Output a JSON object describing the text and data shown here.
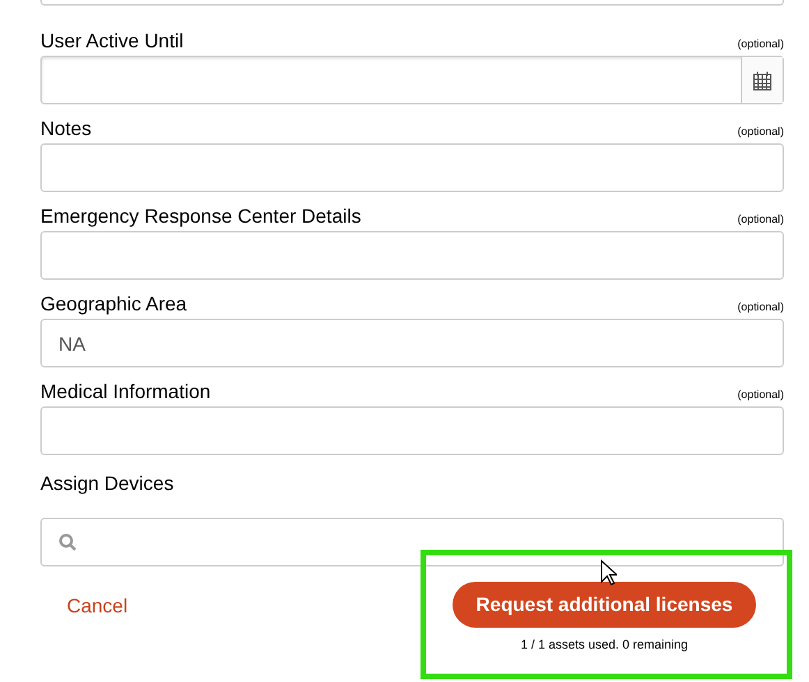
{
  "fields": [
    {
      "kind": "date",
      "label": "User Active Until",
      "note": "(optional)"
    },
    {
      "kind": "text",
      "label": "Notes",
      "note": "(optional)"
    },
    {
      "kind": "text",
      "label": "Emergency Response Center Details",
      "note": "(optional)"
    },
    {
      "kind": "text",
      "label": "Geographic Area",
      "note": "(optional)",
      "value": "NA"
    },
    {
      "kind": "text",
      "label": "Medical Information",
      "note": "(optional)"
    }
  ],
  "assign_devices": {
    "label": "Assign Devices"
  },
  "cancel": "Cancel",
  "request_button": "Request additional licenses",
  "usage": "1 / 1 assets used. 0 remaining"
}
